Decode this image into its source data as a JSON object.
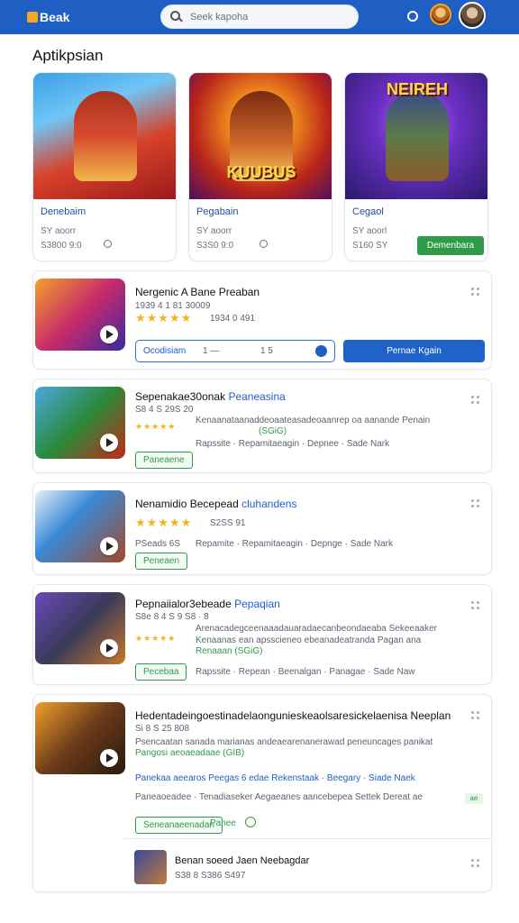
{
  "header": {
    "logo_text": "Beak",
    "search_placeholder": "Seek kapoha",
    "accent_color": "#1f5fc4"
  },
  "section": {
    "title": "Aptikpsian"
  },
  "featured": [
    {
      "name": "Denebaim",
      "sub": "SY aoorr",
      "meta": "S3800 9:0",
      "art_label": ""
    },
    {
      "name": "Pegabain",
      "sub": "SY aoorr",
      "meta": "S3S0 9:0",
      "art_label": "KUUBUS"
    },
    {
      "name": "Cegaol",
      "sub": "SY aoorl",
      "meta": "S160 SY",
      "art_label": "NEIREH",
      "button": "Demenbara"
    }
  ],
  "list": [
    {
      "title": "Nergenic A Bane Preaban",
      "line1": "1939 4 1 81 30009",
      "rating_text": "1934 0 491",
      "field_left": "Ocodisiam",
      "field_mid": "1 —",
      "field_right": "1 5",
      "button": "Pernae Kgain"
    },
    {
      "title": "Sepenakae30onak",
      "title_hl": "Peaneasina",
      "line1": "S8 4 S 29S 20",
      "desc": "Kenaanataanaddeoaateasadeoaanrep oa aanande Penain",
      "desc_tag": "(SGiG)",
      "links": "Rapssite · Repamitaeagin · Depnee · Sade Nark",
      "tag": "Paneaene"
    },
    {
      "title": "Nenamidio Becepead",
      "title_hl": "cluhandens",
      "rating_text": "S2SS 91",
      "line1": "PSeads 6S",
      "links": "Repamite · Repamitaeagin · Depnge · Sade Nark",
      "tag": "Peneaen"
    },
    {
      "title": "Pepnaiialor3ebeade",
      "title_hl": "Pepaqian",
      "line1": "S8e 8 4 S 9 S8 · 8",
      "desc": "Arenacadegceenaaadauaradaecanbeondaeaba Sekeeaaker",
      "desc2": "Kenaanas ean apsscieneo ebeanadeatranda Pagan ana",
      "desc3": "Renaaan (SGiG)",
      "links": "Rapssite · Repean · Beenalgan · Panagae · Sade Naw",
      "tag": "Pecebaa"
    },
    {
      "title": "Hedentadeingoestinadelaongunieskeaolsaresickelaenisa Neeplang",
      "line1": "Si 8 S 25 808",
      "desc": "Psencaatan sanada marianas andeaearenanerawad peneuncages panikat",
      "desc2": "Pangosi aeoaeadaae (GIB)",
      "links": "Panekaa aeearos Peegas 6 edae Rekenstaak · Beegary · Siade Naek",
      "links2": "Paneaoeadee · Tenadiaseker Aegaeanes aancebepea Settek Dereat ae",
      "badge": "ae",
      "tag": "Seneanaeenadan",
      "tag_text": "Panee",
      "sub_title": "Benan soeed Jaen Neebagdar",
      "sub_meta": "S38 8 S386 S497"
    }
  ]
}
